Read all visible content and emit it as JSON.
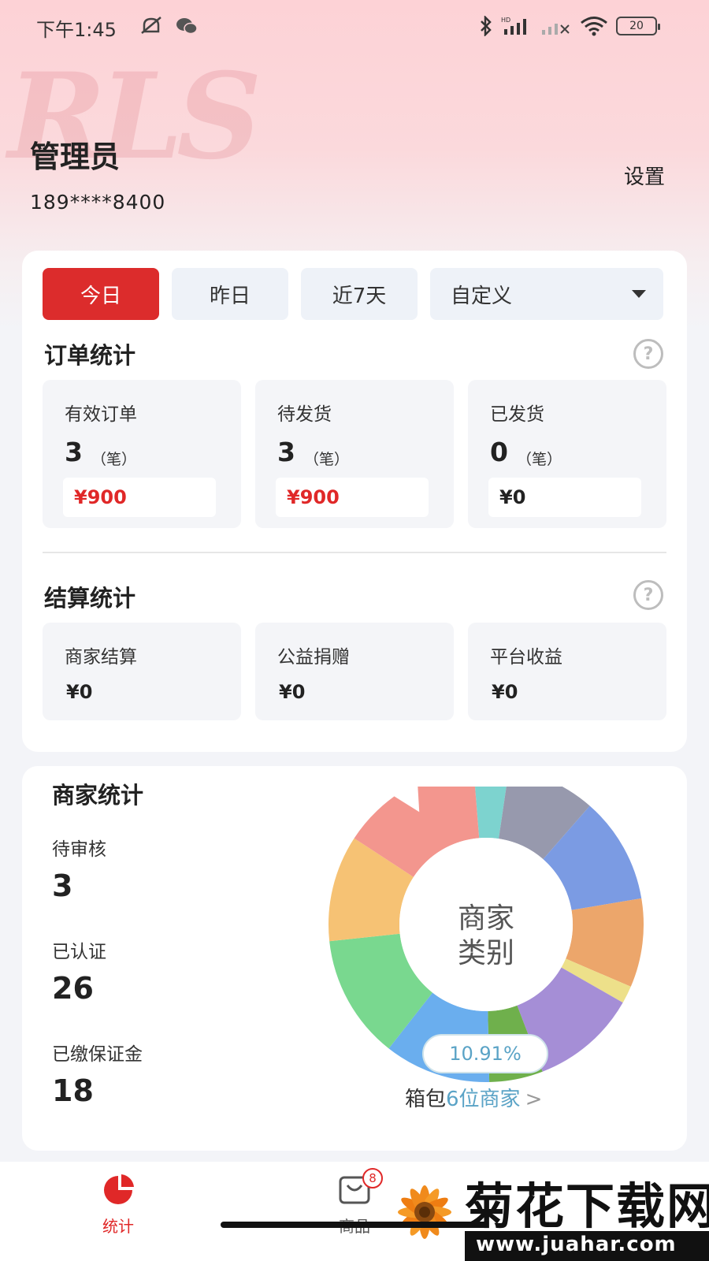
{
  "status_bar": {
    "time": "下午1:45",
    "battery": "20",
    "icons": [
      "mute-icon",
      "wechat-icon",
      "bluetooth-icon",
      "hd-signal-icon",
      "signal-icon",
      "wifi-icon",
      "battery-icon"
    ]
  },
  "header": {
    "name": "管理员",
    "phone": "189****8400",
    "settings_label": "设置",
    "logo_watermark": "RLS"
  },
  "date_tabs": {
    "today": "今日",
    "yesterday": "昨日",
    "last7": "近7天",
    "custom": "自定义",
    "active": "today"
  },
  "order_stats": {
    "title": "订单统计",
    "items": [
      {
        "label": "有效订单",
        "count": "3",
        "unit": "（笔）",
        "amount": "¥900",
        "highlight": true
      },
      {
        "label": "待发货",
        "count": "3",
        "unit": "（笔）",
        "amount": "¥900",
        "highlight": true
      },
      {
        "label": "已发货",
        "count": "0",
        "unit": "（笔）",
        "amount": "¥0",
        "highlight": false
      }
    ]
  },
  "settlement_stats": {
    "title": "结算统计",
    "items": [
      {
        "label": "商家结算",
        "amount": "¥0"
      },
      {
        "label": "公益捐赠",
        "amount": "¥0"
      },
      {
        "label": "平台收益",
        "amount": "¥0"
      }
    ]
  },
  "merchant_stats": {
    "title": "商家统计",
    "pending_label": "待审核",
    "pending_value": "3",
    "certified_label": "已认证",
    "certified_value": "26",
    "deposit_label": "已缴保证金",
    "deposit_value": "18",
    "donut_center_line1": "商家",
    "donut_center_line2": "类别",
    "selected_percent": "10.91%",
    "selected_category": "箱包",
    "selected_link": "6位商家",
    "chevron": ">"
  },
  "chart_data": {
    "type": "pie",
    "donut": true,
    "selected_index": 10,
    "slices": [
      {
        "value": 3.6,
        "color": "#7dd3cf"
      },
      {
        "value": 9.1,
        "color": "#9799ad"
      },
      {
        "value": 10.9,
        "color": "#7b9be3"
      },
      {
        "value": 9.1,
        "color": "#eca66b"
      },
      {
        "value": 1.8,
        "color": "#ede08a"
      },
      {
        "value": 10.9,
        "color": "#a58ed6"
      },
      {
        "value": 5.5,
        "color": "#6fb04c"
      },
      {
        "value": 10.91,
        "color": "#6aaeee"
      },
      {
        "value": 12.7,
        "color": "#79d88f"
      },
      {
        "value": 10.9,
        "color": "#f6c274"
      },
      {
        "value": 14.5,
        "color": "#f3968e"
      }
    ]
  },
  "bottom_nav": {
    "stats_label": "统计",
    "goods_label": "商品",
    "goods_badge": "8",
    "active": "stats"
  },
  "site_watermark": {
    "title": "菊花下载网",
    "url": "www.juahar.com"
  },
  "colors": {
    "accent": "#dc2c2c",
    "link": "#5aa3c6",
    "hero_pink": "#fdd2d6"
  }
}
